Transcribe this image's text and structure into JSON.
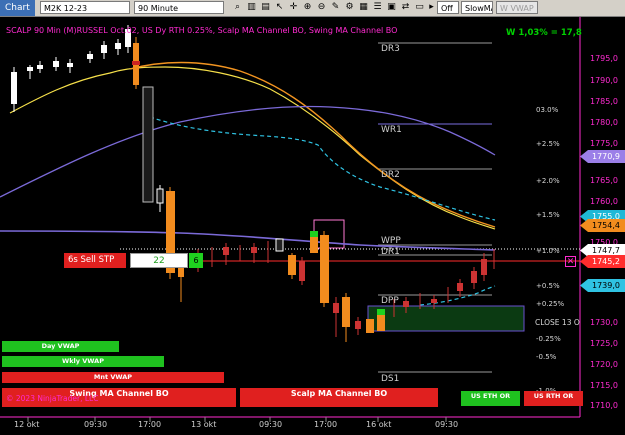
{
  "toolbar": {
    "tab_label": "Chart",
    "instrument": "M2K 12-23",
    "timeframe": "90 Minute",
    "toggle_off": "Off",
    "slow_ma": "SlowMA",
    "w_vwap": "W VWAP"
  },
  "chart_info": {
    "indicator_line": "SCALP 90 Min (M)RUSSEL Oct.02, US Dy RTH 0.25%, Scalp MA Channel BO, Swing MA Channel BO",
    "pl_text": "W 1,03% = 17,8"
  },
  "price_axis": {
    "ticks": [
      "1795,0",
      "1790,0",
      "1785,0",
      "1780,0",
      "1775,0",
      "1765,0",
      "1760,0",
      "1750,0",
      "1730,0",
      "1725,0",
      "1720,0",
      "1715,0",
      "1710,0"
    ],
    "tags": [
      {
        "text": "1770,9",
        "bg": "#9b7fe8",
        "fg": "#ffffff"
      },
      {
        "text": "1755,0",
        "bg": "#1fb8d6",
        "fg": "#ffffff"
      },
      {
        "text": "1754,4",
        "bg": "#f28c1e",
        "fg": "#000000"
      },
      {
        "text": "1747,7",
        "bg": "#ffffff",
        "fg": "#000000"
      },
      {
        "text": "1745,2",
        "bg": "#ff2d2d",
        "fg": "#ffffff"
      },
      {
        "text": "1739,0",
        "bg": "#2fc3e3",
        "fg": "#000000"
      }
    ]
  },
  "time_axis": {
    "ticks": [
      "12 okt",
      "09:30",
      "17:00",
      "13 okt",
      "09:30",
      "17:00",
      "16 okt",
      "09:30"
    ]
  },
  "levels": {
    "labels": [
      "DR3",
      "WR1",
      "DR2",
      "WPP",
      "DR1",
      "DPP",
      "DS1"
    ],
    "percents": [
      "03.0%",
      "+2.5%",
      "+2.0%",
      "+1.5%",
      "+1.0%",
      "+0.5%",
      "+0.25%",
      "-0.25%",
      "-0.5%",
      "-1.0%"
    ],
    "close_label": "CLOSE 13 O"
  },
  "order_row": {
    "label": "6s  Sell STP",
    "quantity": "22",
    "suffix": "6"
  },
  "signal_buttons": {
    "day_vwap": "Day VWAP",
    "wkly_vwap": "Wkly VWAP",
    "mnt_vwap": "Mnt VWAP",
    "swing_channel": "Swing MA Channel BO",
    "scalp_channel": "Scalp MA Channel BO",
    "us_eth_or": "US ETH OR",
    "us_rth_or": "US RTH OR"
  },
  "copyright": "© 2023 NinjaTrader, LLC",
  "colors": {
    "accent_magenta": "#ff2bd1",
    "bull": "#ffffff",
    "bear": "#ff8c1a",
    "green_box": "#0b3a12"
  }
}
